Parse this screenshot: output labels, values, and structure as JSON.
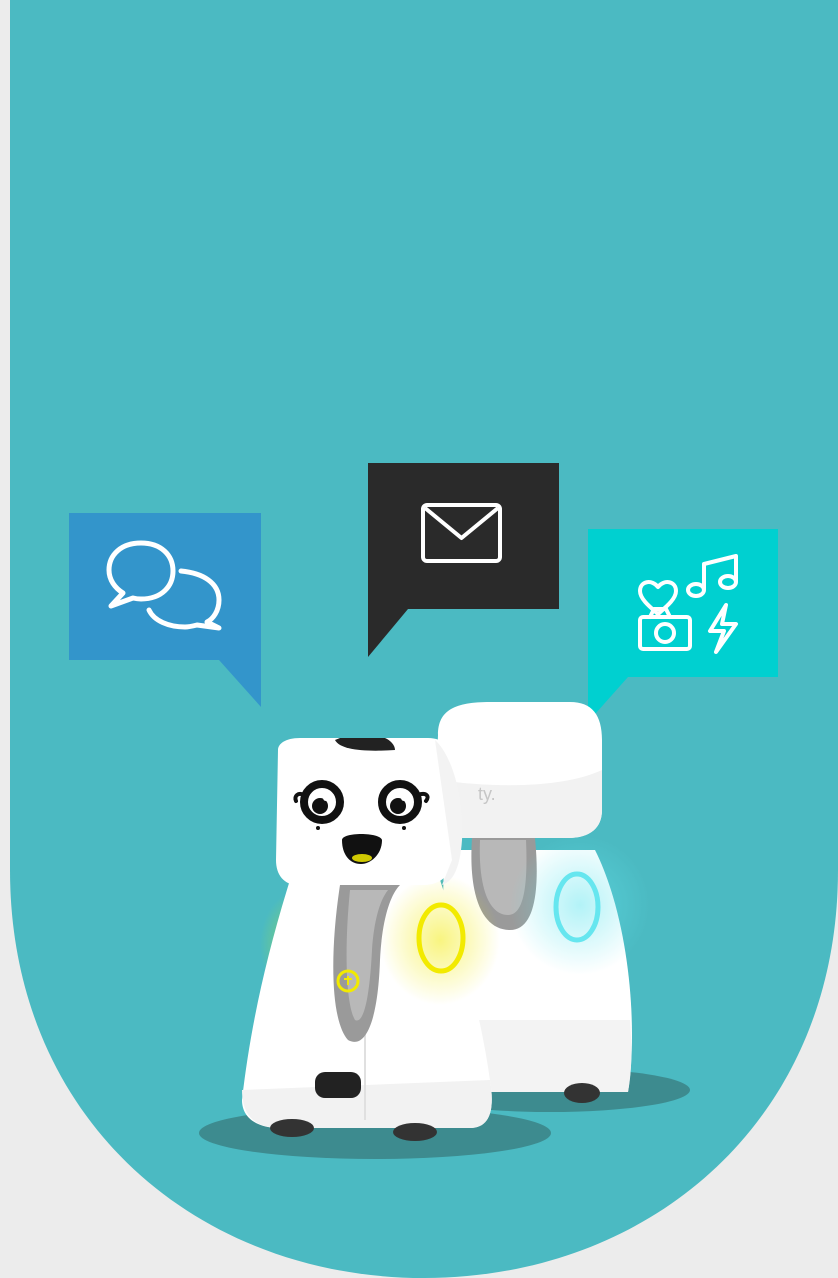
{
  "colors": {
    "page_background": "#ececec",
    "banner": "#4bbac2",
    "chat_bubble": "#3395cb",
    "mail_bubble": "#2a2a2a",
    "media_bubble": "#00d0d0",
    "icon_stroke": "#ffffff",
    "shadow": "#3d8b8f",
    "robot_body": "#ffffff",
    "robot_neck": "#9a9a9a",
    "led_yellow": "#f2ea00",
    "led_green": "#8ed85a",
    "led_cyan": "#66e6ef"
  },
  "icons": {
    "chat": "chat-bubbles-icon",
    "mail": "envelope-icon",
    "media": [
      "heart-icon",
      "music-note-icon",
      "camera-icon",
      "lightning-icon"
    ]
  },
  "robot": {
    "back_logo_text": "ty."
  }
}
